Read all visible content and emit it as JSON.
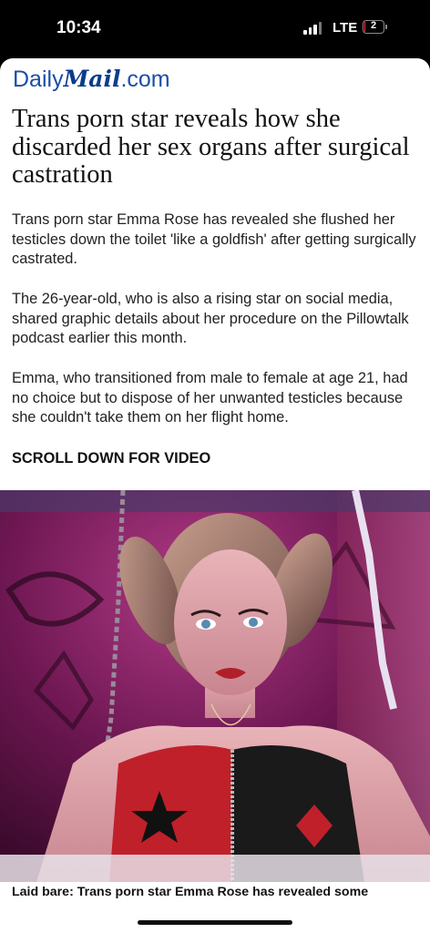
{
  "status_bar": {
    "time": "10:34",
    "network": "LTE",
    "battery": "2",
    "battery_level_percent": 2
  },
  "header": {
    "logo_daily": "Daily",
    "logo_mail": "Mail",
    "logo_com": ".com"
  },
  "article": {
    "headline": "Trans porn star reveals how she discarded her sex organs after surgical castration",
    "paragraphs": [
      "Trans porn star Emma Rose has revealed she flushed her testicles down the toilet 'like a goldfish' after getting surgically castrated.",
      "The 26-year-old, who is also a rising star on social media, shared graphic details about her procedure on the Pillowtalk podcast earlier this month.",
      "Emma, who transitioned from male to female at age 21, had no choice but to dispose of her unwanted testicles because she couldn't take them on her flight home."
    ],
    "scroll_note": "SCROLL DOWN FOR VIDEO",
    "image_caption": "Laid bare: Trans porn star Emma Rose has revealed some"
  },
  "colors": {
    "brand": "#0b3c8c",
    "photo_bg": "#5a1040"
  }
}
